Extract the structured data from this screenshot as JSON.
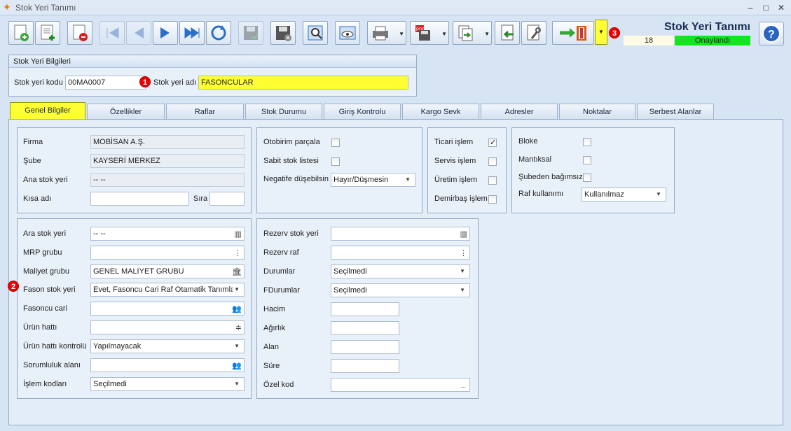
{
  "window": {
    "title": "Stok Yeri Tanımı",
    "min": "–",
    "max": "□",
    "close": "✕"
  },
  "header": {
    "title": "Stok Yeri Tanımı",
    "count": "18",
    "status": "Onaylandı"
  },
  "badges": [
    "1",
    "2",
    "3"
  ],
  "colors": {
    "accent_yellow": "#ffff33",
    "status_green": "#14e61e",
    "badge_red": "#ee0000"
  },
  "info": {
    "group_title": "Stok Yeri Bilgileri",
    "code_label": "Stok yeri kodu",
    "code_value": "00MA0007",
    "name_label": "Stok yeri adı",
    "name_value": "FASONCULAR"
  },
  "tabs": [
    "Genel Bilgiler",
    "Özellikler",
    "Raflar",
    "Stok Durumu",
    "Giriş Kontrolu",
    "Kargo Sevk",
    "Adresler",
    "Noktalar",
    "Serbest Alanlar"
  ],
  "general": {
    "firma_label": "Firma",
    "firma_value": "MOBİSAN A.Ş.",
    "sube_label": "Şube",
    "sube_value": "KAYSERİ MERKEZ",
    "ana_label": "Ana stok yeri",
    "ana_value": "-- --",
    "kisa_label": "Kısa adı",
    "kisa_value": "",
    "sira_label": "Sıra",
    "sira_value": ""
  },
  "parca": {
    "otobirim_label": "Otobirim parçala",
    "otobirim_checked": false,
    "sabit_label": "Sabit stok listesi",
    "sabit_checked": false,
    "negatif_label": "Negatife düşebilsin",
    "negatif_value": "Hayır/Düşmesin"
  },
  "islem": {
    "ticari_label": "Ticari işlem",
    "ticari_checked": true,
    "servis_label": "Servis işlem",
    "servis_checked": false,
    "uretim_label": "Üretim işlem",
    "uretim_checked": false,
    "demirbas_label": "Demirbaş işlem",
    "demirbas_checked": false
  },
  "bloke": {
    "bloke_label": "Bloke",
    "mantiksal_label": "Mantıksal",
    "subeden_label": "Şubeden bağımsız",
    "raf_label": "Raf kullanımı",
    "raf_value": "Kullanılmaz"
  },
  "left2": {
    "ara_label": "Ara stok yeri",
    "ara_value": "-- --",
    "mrp_label": "MRP grubu",
    "mrp_value": "",
    "maliyet_label": "Maliyet grubu",
    "maliyet_value": "GENEL MALIYET GRUBU",
    "fason_label": "Fason stok yeri",
    "fason_value": "Evet, Fasoncu Cari Raf Otamatik Tanımla",
    "fasoncu_label": "Fasoncu cari",
    "fasoncu_value": "",
    "urun_label": "Ürün hattı",
    "urun_value": "",
    "urunk_label": "Ürün hattı kontrolü",
    "urunk_value": "Yapılmayacak",
    "sorum_label": "Sorumluluk alanı",
    "sorum_value": "",
    "islemk_label": "İşlem kodları",
    "islemk_value": "Seçilmedi"
  },
  "right2": {
    "rezerv_label": "Rezerv stok yeri",
    "rezerv_value": "",
    "rezervraf_label": "Rezerv raf",
    "rezervraf_value": "",
    "durum_label": "Durumlar",
    "durum_value": "Seçilmedi",
    "fdurum_label": "FDurumlar",
    "fdurum_value": "Seçilmedi",
    "hacim_label": "Hacim",
    "agirlik_label": "Ağırlık",
    "alan_label": "Alan",
    "sure_label": "Süre",
    "ozel_label": "Özel kod",
    "ozel_value": "",
    "ozel_btn": "..."
  }
}
